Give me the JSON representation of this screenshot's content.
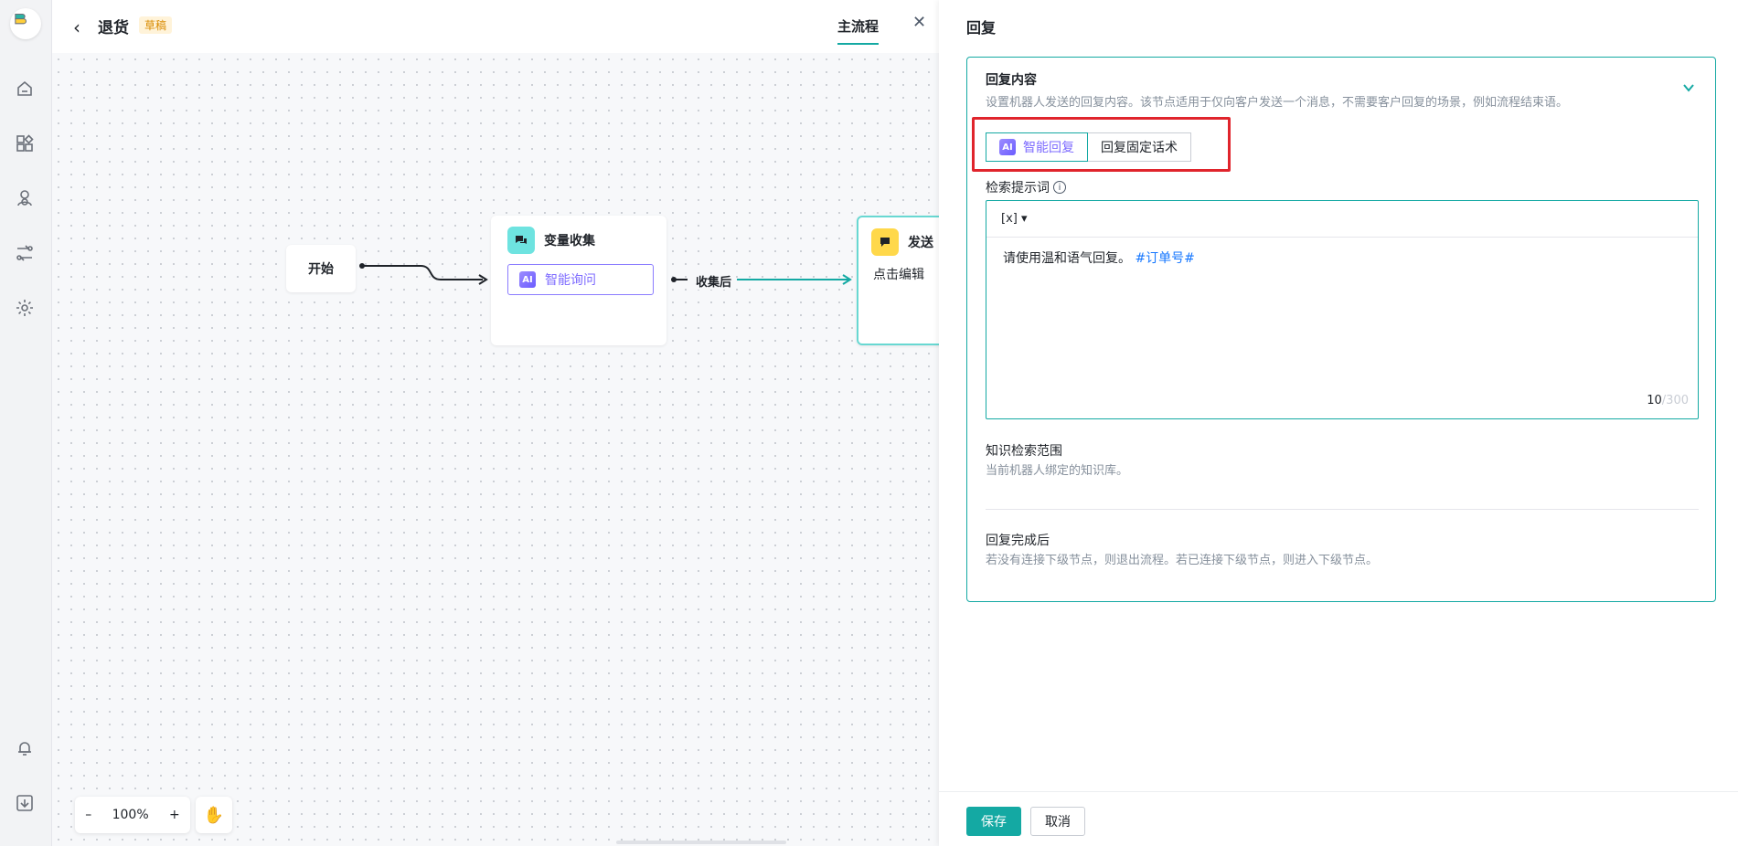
{
  "header": {
    "title": "退货",
    "status_badge": "草稿",
    "tab_main": "主流程"
  },
  "rail": {
    "icons": [
      "home-icon",
      "apps-icon",
      "user-icon",
      "flow-icon",
      "settings-icon",
      "bell-icon",
      "download-icon"
    ]
  },
  "canvas": {
    "nodes": {
      "start": {
        "label": "开始"
      },
      "collect": {
        "title": "变量收集",
        "ai_label": "智能询问",
        "ai_badge": "AI"
      },
      "send": {
        "title": "发送",
        "body": "点击编辑"
      }
    },
    "edge_label": "收集后",
    "zoom": {
      "minus": "–",
      "level": "100%",
      "plus": "+"
    }
  },
  "panel": {
    "title": "回复",
    "section": {
      "title": "回复内容",
      "desc": "设置机器人发送的回复内容。该节点适用于仅向客户发送一个消息，不需要客户回复的场景，例如流程结束语。"
    },
    "mode_tabs": {
      "ai_badge": "AI",
      "ai": "智能回复",
      "fixed": "回复固定话术"
    },
    "prompt": {
      "label": "检索提示词",
      "toolbar": "[x]",
      "text": "请使用温和语气回复。",
      "tag": "#订单号#",
      "count": "10",
      "max": "/300"
    },
    "knowledge": {
      "title": "知识检索范围",
      "desc": "当前机器人绑定的知识库。"
    },
    "after": {
      "title": "回复完成后",
      "desc": "若没有连接下级节点，则退出流程。若已连接下级节点，则进入下级节点。"
    },
    "footer": {
      "save": "保存",
      "cancel": "取消"
    }
  },
  "colors": {
    "accent": "#14a9a3",
    "ai_purple": "#7d6bff",
    "highlight_red": "#e0242c"
  }
}
